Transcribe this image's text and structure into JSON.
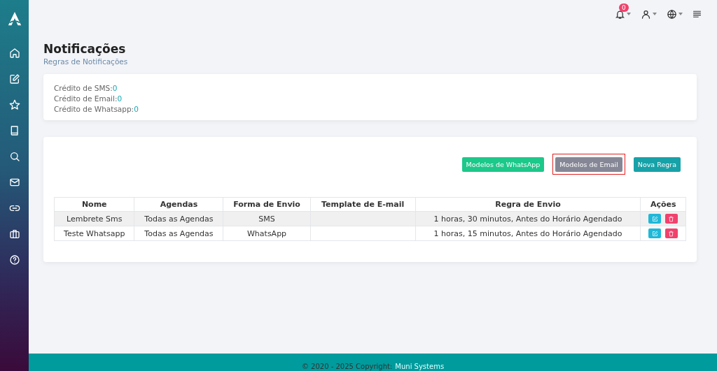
{
  "sidebar": {
    "items": [
      {
        "kind": "home"
      },
      {
        "kind": "edit"
      },
      {
        "kind": "star"
      },
      {
        "kind": "book"
      },
      {
        "kind": "search"
      },
      {
        "kind": "mail"
      },
      {
        "kind": "link"
      },
      {
        "kind": "briefcase"
      },
      {
        "kind": "help"
      }
    ]
  },
  "topbar": {
    "notification_count": "0"
  },
  "header": {
    "title": "Notificações",
    "subtitle": "Regras de Notificações"
  },
  "credits": [
    {
      "label": "Crédito de SMS:",
      "value": "0"
    },
    {
      "label": "Crédito de Email:",
      "value": "0"
    },
    {
      "label": "Crédito de Whatsapp:",
      "value": "0"
    }
  ],
  "buttons": [
    {
      "label": "Modelos de WhatsApp",
      "color": "#1cc88a",
      "highlighted": false
    },
    {
      "label": "Modelos de Email",
      "color": "#858796",
      "highlighted": true
    },
    {
      "label": "Nova Regra",
      "color": "#17a2a8",
      "highlighted": false
    }
  ],
  "table": {
    "columns": [
      "Nome",
      "Agendas",
      "Forma de Envio",
      "Template de E-mail",
      "Regra de Envio",
      "Ações"
    ],
    "rows": [
      {
        "cells": [
          "Lembrete Sms",
          "Todas as Agendas",
          "SMS",
          "",
          "1 horas, 30 minutos, Antes do Horário Agendado"
        ]
      },
      {
        "cells": [
          "Teste Whatsapp",
          "Todas as Agendas",
          "WhatsApp",
          "",
          "1 horas, 15 minutos, Antes do Horário Agendado"
        ]
      }
    ]
  },
  "footer": {
    "text": "© 2020 - 2025 Copyright:",
    "link": "Muni Systems"
  }
}
